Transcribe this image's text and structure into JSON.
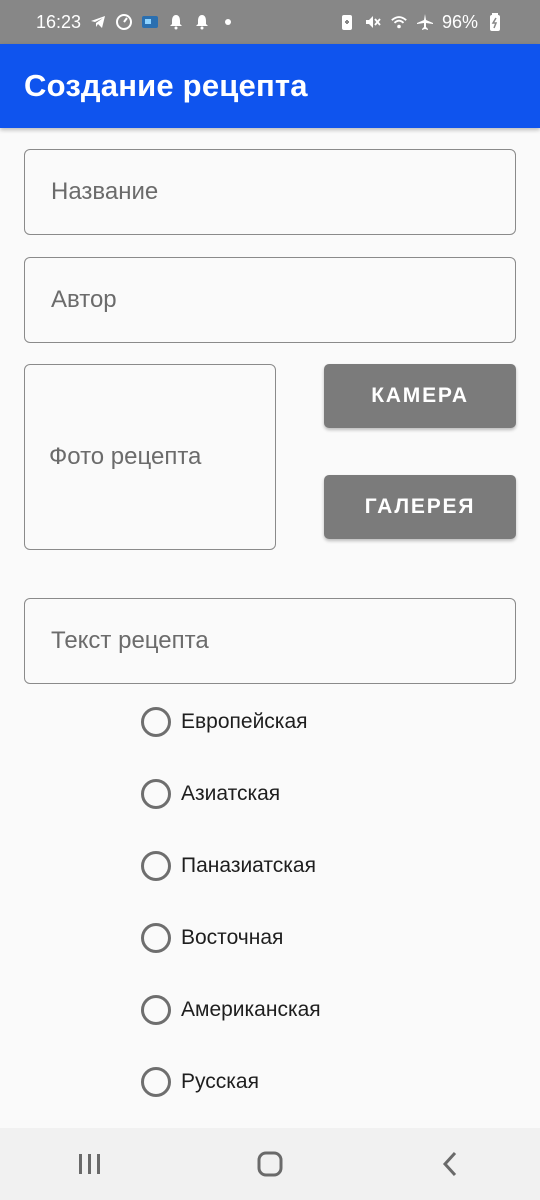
{
  "status_bar": {
    "time": "16:23",
    "battery": "96%",
    "icons_left": [
      "telegram-icon",
      "speedometer-icon",
      "app-badge-icon",
      "bell-icon",
      "bell-icon",
      "dot-icon"
    ],
    "icons_right": [
      "battery-saver-icon",
      "mute-icon",
      "wifi-icon",
      "airplane-icon",
      "battery-icon"
    ]
  },
  "app_bar": {
    "title": "Создание рецепта",
    "color": "#0f54ee"
  },
  "form": {
    "name_placeholder": "Название",
    "author_placeholder": "Автор",
    "photo_label": "Фото рецепта",
    "camera_button": "КАМЕРА",
    "gallery_button": "ГАЛЕРЕЯ",
    "text_placeholder": "Текст рецепта"
  },
  "cuisines": [
    {
      "label": "Европейская",
      "selected": false
    },
    {
      "label": "Азиатская",
      "selected": false
    },
    {
      "label": "Паназиатская",
      "selected": false
    },
    {
      "label": "Восточная",
      "selected": false
    },
    {
      "label": "Американская",
      "selected": false
    },
    {
      "label": "Русская",
      "selected": false
    }
  ],
  "nav_bar": {
    "icons": [
      "recents-icon",
      "home-icon",
      "back-icon"
    ]
  }
}
